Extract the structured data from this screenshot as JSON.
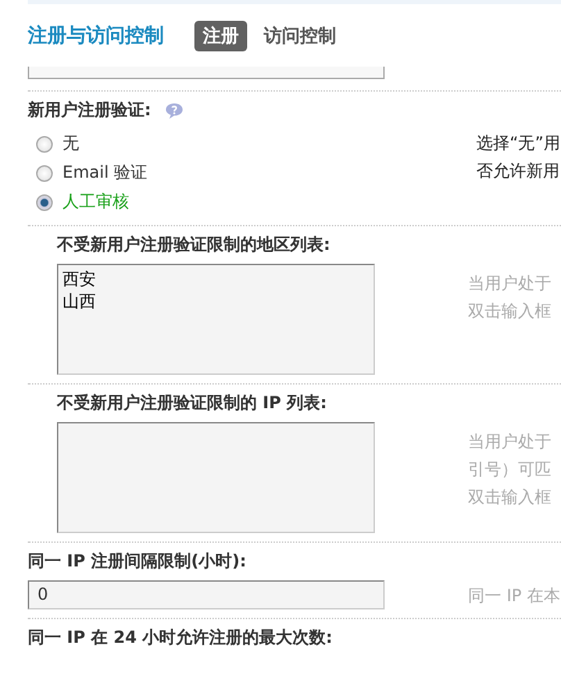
{
  "header": {
    "title": "注册与访问控制",
    "tabs": [
      {
        "label": "注册",
        "selected": true
      },
      {
        "label": "访问控制",
        "selected": false
      }
    ]
  },
  "sections": [
    {
      "kind": "field_edge"
    },
    {
      "kind": "radio",
      "label": "新用户注册验证:",
      "help_icon": true,
      "hint": [
        "选择“无”用",
        "否允许新用"
      ],
      "options": [
        {
          "label": "无",
          "selected": false
        },
        {
          "label": "Email 验证",
          "selected": false
        },
        {
          "label": "人工审核",
          "selected": true
        }
      ]
    },
    {
      "kind": "textarea",
      "indented": true,
      "label": "不受新用户注册验证限制的地区列表:",
      "lines": [
        "西安",
        "山西"
      ],
      "hint": [
        "当用户处于",
        "双击输入框"
      ]
    },
    {
      "kind": "textarea",
      "indented": true,
      "label": "不受新用户注册验证限制的 IP 列表:",
      "hint": [
        "当用户处于",
        "引号）可匹",
        "双击输入框"
      ]
    },
    {
      "kind": "input",
      "label": "同一 IP 注册间隔限制(小时):",
      "value": "0",
      "hint": [
        "同一 IP 在本"
      ]
    },
    {
      "kind": "label",
      "label": "同一 IP 在 24 小时允许注册的最大次数:"
    }
  ]
}
